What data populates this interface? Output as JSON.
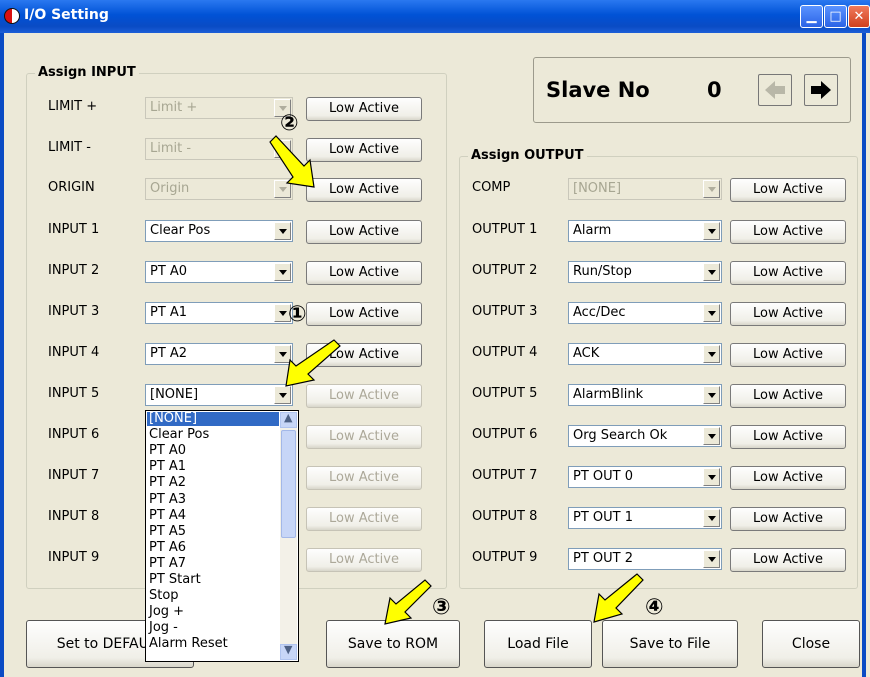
{
  "window": {
    "title": "I/O Setting",
    "app_icon": "app-icon",
    "controls": [
      "minimize-icon",
      "maximize-icon",
      "close-icon"
    ],
    "accent": "#0a4bc4"
  },
  "input_group": {
    "title": "Assign INPUT",
    "rows": [
      {
        "label": "LIMIT +",
        "value": "Limit +",
        "disabled_combo": true,
        "button": "Low Active",
        "button_disabled": false
      },
      {
        "label": "LIMIT -",
        "value": "Limit -",
        "disabled_combo": true,
        "button": "Low Active",
        "button_disabled": false
      },
      {
        "label": "ORIGIN",
        "value": "Origin",
        "disabled_combo": true,
        "button": "Low Active",
        "button_disabled": false
      },
      {
        "label": "INPUT 1",
        "value": "Clear Pos",
        "disabled_combo": false,
        "button": "Low Active",
        "button_disabled": false
      },
      {
        "label": "INPUT 2",
        "value": "PT A0",
        "disabled_combo": false,
        "button": "Low Active",
        "button_disabled": false
      },
      {
        "label": "INPUT 3",
        "value": "PT A1",
        "disabled_combo": false,
        "button": "Low Active",
        "button_disabled": false
      },
      {
        "label": "INPUT 4",
        "value": "PT A2",
        "disabled_combo": false,
        "button": "Low Active",
        "button_disabled": false
      },
      {
        "label": "INPUT 5",
        "value": "[NONE]",
        "disabled_combo": false,
        "button": "Low Active",
        "button_disabled": true
      },
      {
        "label": "INPUT 6",
        "value": "",
        "disabled_combo": false,
        "button": "Low Active",
        "button_disabled": true
      },
      {
        "label": "INPUT 7",
        "value": "",
        "disabled_combo": false,
        "button": "Low Active",
        "button_disabled": true
      },
      {
        "label": "INPUT 8",
        "value": "",
        "disabled_combo": false,
        "button": "Low Active",
        "button_disabled": true
      },
      {
        "label": "INPUT 9",
        "value": "",
        "disabled_combo": false,
        "button": "Low Active",
        "button_disabled": true
      }
    ]
  },
  "dropdown": {
    "selected_index": 0,
    "items": [
      "[NONE]",
      "Clear Pos",
      "PT A0",
      "PT A1",
      "PT A2",
      "PT A3",
      "PT A4",
      "PT A5",
      "PT A6",
      "PT A7",
      "PT Start",
      "Stop",
      "Jog +",
      "Jog -",
      "Alarm Reset"
    ]
  },
  "slave": {
    "label": "Slave No",
    "value": "0",
    "prev_icon": "arrow-left-icon",
    "next_icon": "arrow-right-icon"
  },
  "output_group": {
    "title": "Assign OUTPUT",
    "rows": [
      {
        "label": "COMP",
        "value": "[NONE]",
        "disabled_combo": true,
        "button": "Low Active"
      },
      {
        "label": "OUTPUT 1",
        "value": "Alarm",
        "disabled_combo": false,
        "button": "Low Active"
      },
      {
        "label": "OUTPUT 2",
        "value": "Run/Stop",
        "disabled_combo": false,
        "button": "Low Active"
      },
      {
        "label": "OUTPUT 3",
        "value": "Acc/Dec",
        "disabled_combo": false,
        "button": "Low Active"
      },
      {
        "label": "OUTPUT 4",
        "value": "ACK",
        "disabled_combo": false,
        "button": "Low Active"
      },
      {
        "label": "OUTPUT 5",
        "value": "AlarmBlink",
        "disabled_combo": false,
        "button": "Low Active"
      },
      {
        "label": "OUTPUT 6",
        "value": "Org Search Ok",
        "disabled_combo": false,
        "button": "Low Active"
      },
      {
        "label": "OUTPUT 7",
        "value": "PT OUT 0",
        "disabled_combo": false,
        "button": "Low Active"
      },
      {
        "label": "OUTPUT 8",
        "value": "PT OUT 1",
        "disabled_combo": false,
        "button": "Low Active"
      },
      {
        "label": "OUTPUT 9",
        "value": "PT OUT 2",
        "disabled_combo": false,
        "button": "Low Active"
      }
    ]
  },
  "footer": {
    "set_default": "Set to DEFAULT",
    "save_rom": "Save to ROM",
    "load_file": "Load File",
    "save_file": "Save to File",
    "close": "Close"
  },
  "annotations": {
    "marker_1": "①",
    "marker_2": "②",
    "marker_3": "③",
    "marker_4": "④",
    "arrow_color": "#ffff00"
  }
}
